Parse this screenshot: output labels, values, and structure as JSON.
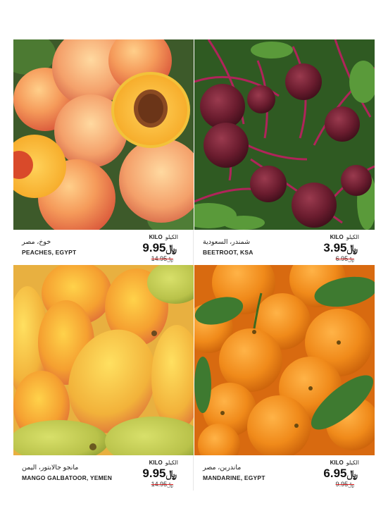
{
  "products": [
    {
      "name_ar": "خوخ، مصر",
      "name_en": "PEACHES, EGYPT",
      "unit_en": "KILO",
      "unit_ar": "الكيلو",
      "price": "9.95",
      "old_price": "14.95",
      "currency_icon": "riyal-icon"
    },
    {
      "name_ar": "شمندر، السعودية",
      "name_en": "BEETROOT, KSA",
      "unit_en": "KILO",
      "unit_ar": "الكيلو",
      "price": "3.95",
      "old_price": "6.95",
      "currency_icon": "riyal-icon"
    },
    {
      "name_ar": "مانجو جالابتور، اليمن",
      "name_en": "MANGO GALBATOOR, YEMEN",
      "unit_en": "KILO",
      "unit_ar": "الكيلو",
      "price": "9.95",
      "old_price": "14.95",
      "currency_icon": "riyal-icon"
    },
    {
      "name_ar": "ماندرين، مصر",
      "name_en": "MANDARINE, EGYPT",
      "unit_en": "KILO",
      "unit_ar": "الكيلو",
      "price": "6.95",
      "old_price": "9.95",
      "currency_icon": "riyal-icon"
    }
  ],
  "currency_symbol": "﷼",
  "colors": {
    "strike": "#e02020",
    "text": "#1a1a1a",
    "background": "#ffffff"
  }
}
